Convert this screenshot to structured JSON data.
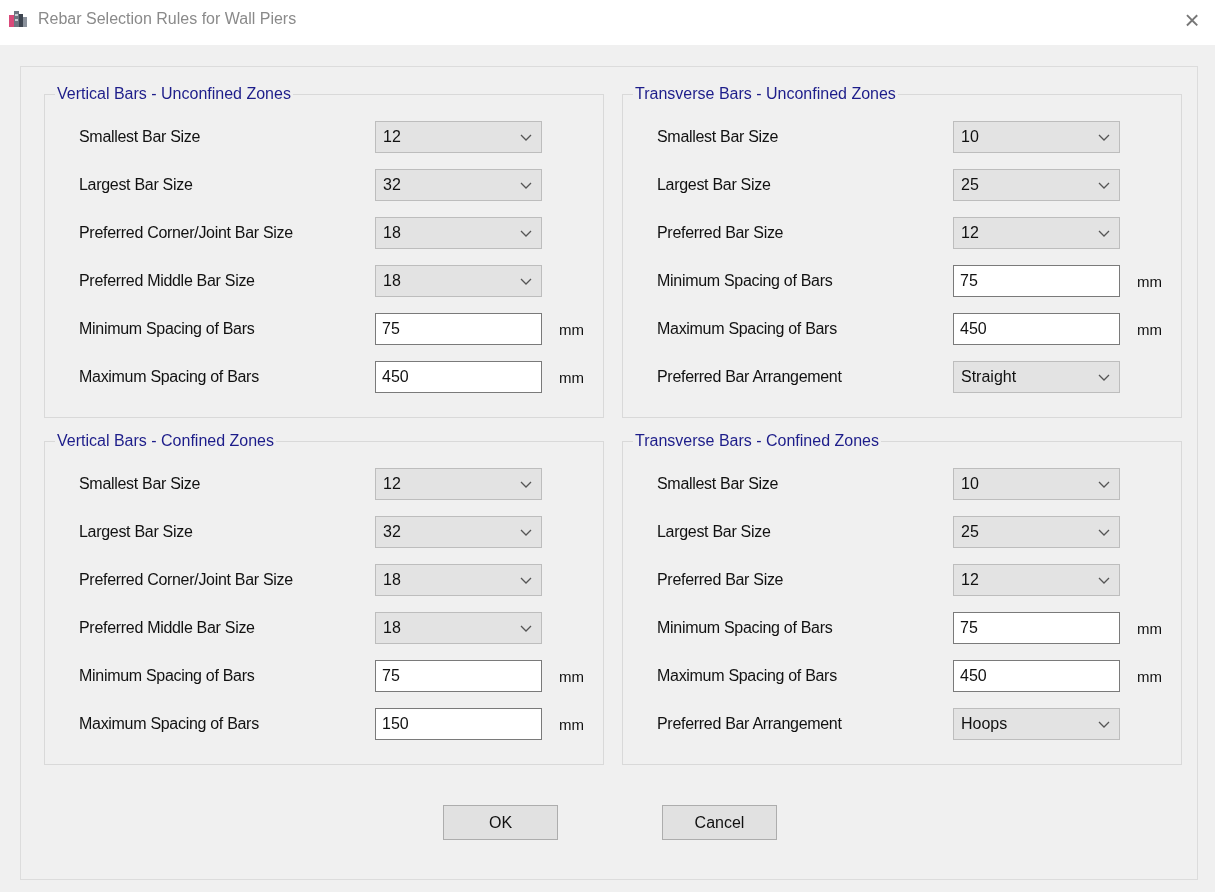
{
  "window": {
    "title": "Rebar Selection Rules for Wall Piers",
    "close": "×"
  },
  "groups": [
    {
      "title": "Vertical Bars - Unconfined Zones",
      "rows": [
        {
          "label": "Smallest Bar Size",
          "kind": "dropdown",
          "value": "12"
        },
        {
          "label": "Largest Bar Size",
          "kind": "dropdown",
          "value": "32"
        },
        {
          "label": "Preferred Corner/Joint Bar Size",
          "kind": "dropdown",
          "value": "18"
        },
        {
          "label": "Preferred Middle Bar Size",
          "kind": "dropdown",
          "value": "18"
        },
        {
          "label": "Minimum Spacing of Bars",
          "kind": "text",
          "value": "75",
          "unit": "mm"
        },
        {
          "label": "Maximum Spacing of Bars",
          "kind": "text",
          "value": "450",
          "unit": "mm"
        }
      ]
    },
    {
      "title": "Transverse Bars - Unconfined Zones",
      "rows": [
        {
          "label": "Smallest Bar Size",
          "kind": "dropdown",
          "value": "10"
        },
        {
          "label": "Largest Bar Size",
          "kind": "dropdown",
          "value": "25"
        },
        {
          "label": "Preferred Bar Size",
          "kind": "dropdown",
          "value": "12"
        },
        {
          "label": "Minimum Spacing of Bars",
          "kind": "text",
          "value": "75",
          "unit": "mm"
        },
        {
          "label": "Maximum Spacing of Bars",
          "kind": "text",
          "value": "450",
          "unit": "mm"
        },
        {
          "label": "Preferred Bar Arrangement",
          "kind": "dropdown",
          "value": "Straight"
        }
      ]
    },
    {
      "title": "Vertical Bars - Confined Zones",
      "rows": [
        {
          "label": "Smallest Bar Size",
          "kind": "dropdown",
          "value": "12"
        },
        {
          "label": "Largest Bar Size",
          "kind": "dropdown",
          "value": "32"
        },
        {
          "label": "Preferred Corner/Joint Bar Size",
          "kind": "dropdown",
          "value": "18"
        },
        {
          "label": "Preferred Middle Bar Size",
          "kind": "dropdown",
          "value": "18"
        },
        {
          "label": "Minimum Spacing of Bars",
          "kind": "text",
          "value": "75",
          "unit": "mm"
        },
        {
          "label": "Maximum Spacing of Bars",
          "kind": "text",
          "value": "150",
          "unit": "mm"
        }
      ]
    },
    {
      "title": "Transverse Bars - Confined Zones",
      "rows": [
        {
          "label": "Smallest Bar Size",
          "kind": "dropdown",
          "value": "10"
        },
        {
          "label": "Largest Bar Size",
          "kind": "dropdown",
          "value": "25"
        },
        {
          "label": "Preferred Bar Size",
          "kind": "dropdown",
          "value": "12"
        },
        {
          "label": "Minimum Spacing of Bars",
          "kind": "text",
          "value": "75",
          "unit": "mm"
        },
        {
          "label": "Maximum Spacing of Bars",
          "kind": "text",
          "value": "450",
          "unit": "mm"
        },
        {
          "label": "Preferred Bar Arrangement",
          "kind": "dropdown",
          "value": "Hoops"
        }
      ]
    }
  ],
  "buttons": [
    "OK",
    "Cancel"
  ]
}
